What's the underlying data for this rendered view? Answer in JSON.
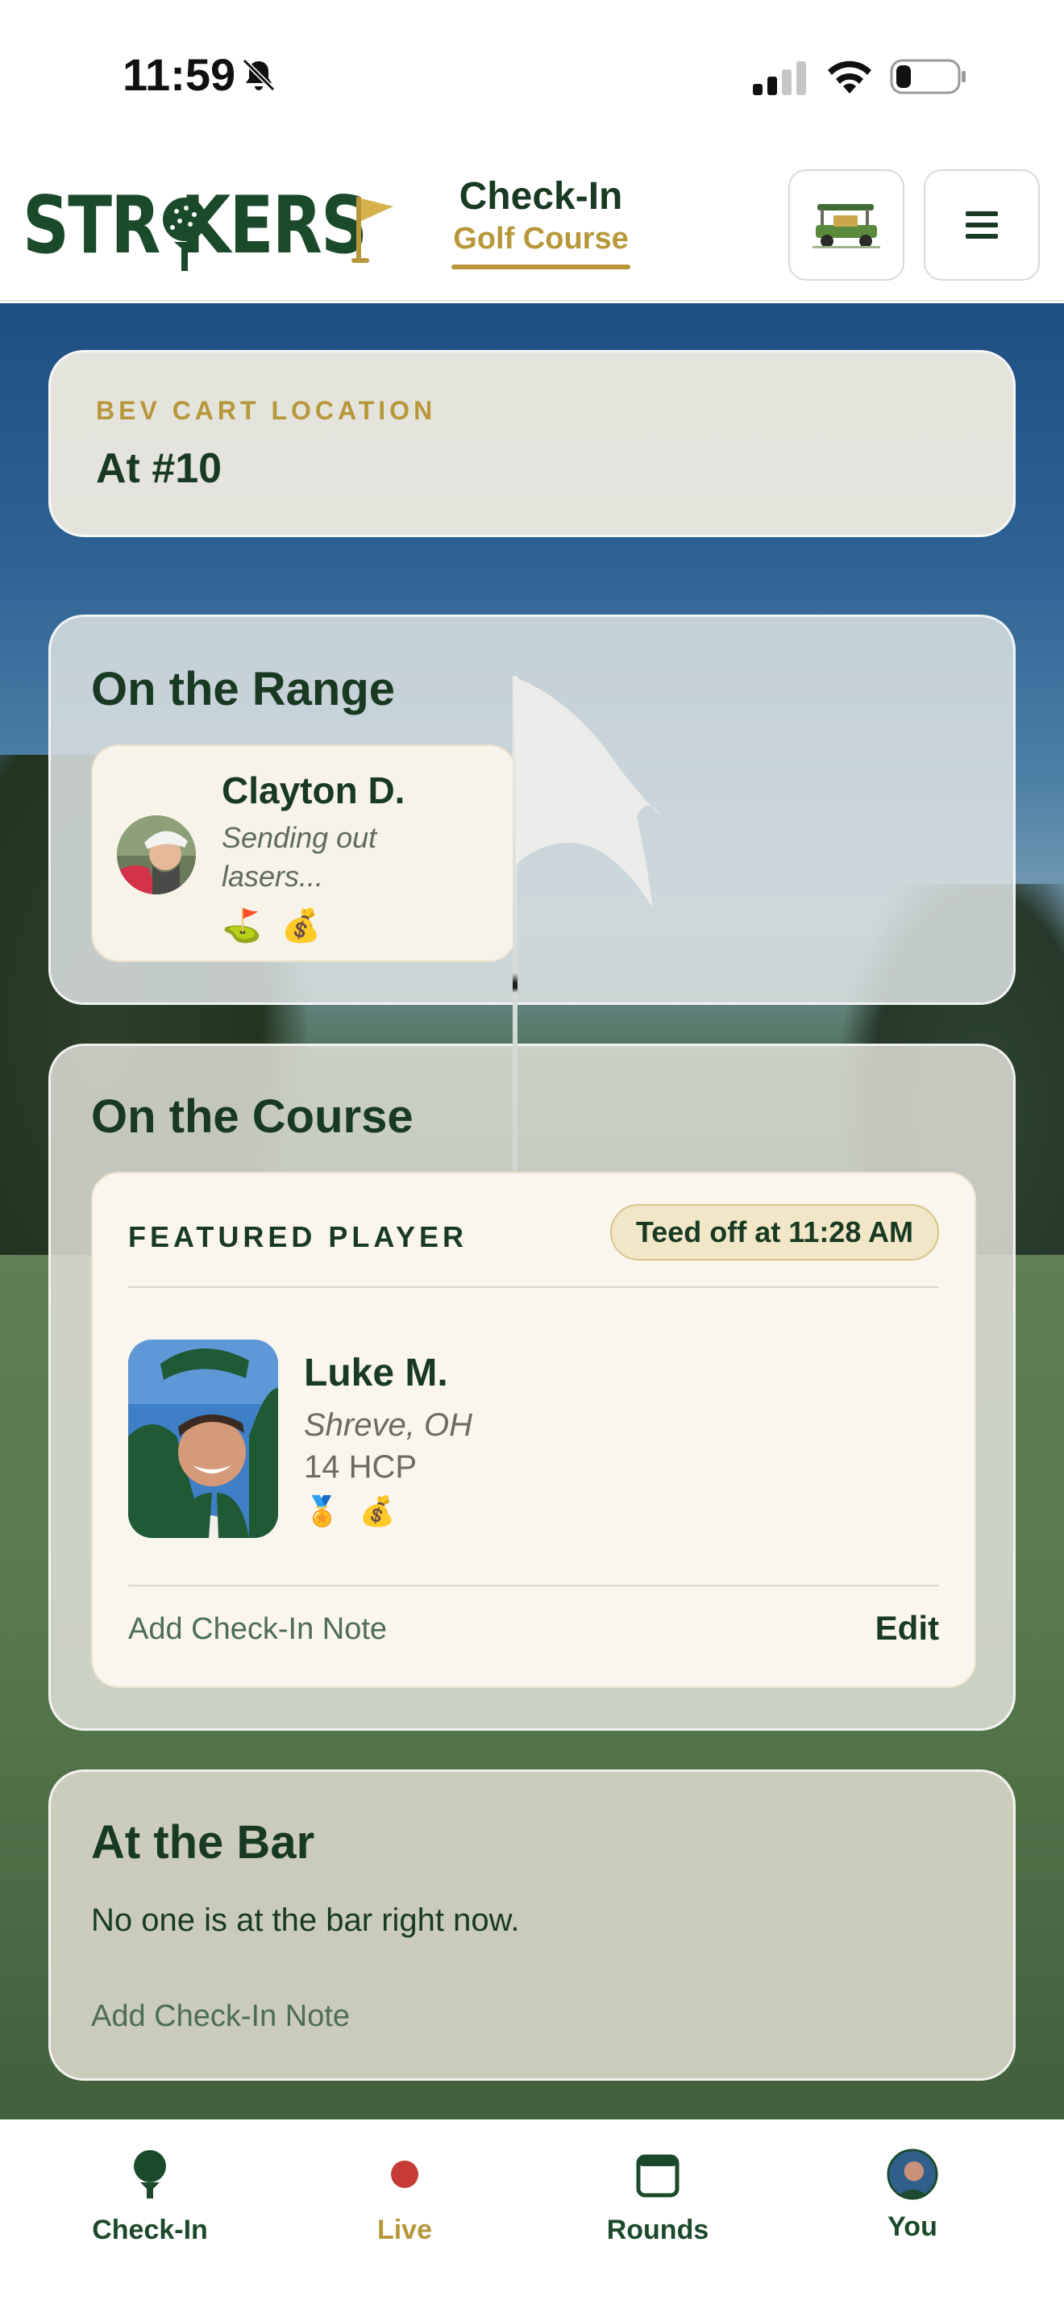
{
  "status_bar": {
    "time": "11:59"
  },
  "header": {
    "logo_text": "STR  KERS",
    "title": "Check-In",
    "subtitle": "Golf Course"
  },
  "bev_cart": {
    "label": "BEV CART LOCATION",
    "value": "At #10"
  },
  "range": {
    "title": "On the Range",
    "player": {
      "name": "Clayton D.",
      "status": "Sending out lasers...",
      "badges": [
        "⛳",
        "💰"
      ]
    }
  },
  "course": {
    "title": "On the Course",
    "featured_label": "FEATURED PLAYER",
    "teed_off": "Teed off at 11:28 AM",
    "player": {
      "name": "Luke M.",
      "location": "Shreve, OH",
      "handicap": "14 HCP",
      "badges": [
        "🏅",
        "💰"
      ]
    },
    "add_note": "Add Check-In Note",
    "edit": "Edit"
  },
  "bar": {
    "title": "At the Bar",
    "empty_text": "No one is at the bar right now.",
    "add_note": "Add Check-In Note"
  },
  "tabs": [
    {
      "label": "Check-In",
      "icon": "golf-ball-tee-icon",
      "color": "#1b4a2a"
    },
    {
      "label": "Live",
      "icon": "live-dot-icon",
      "color": "#b8973a"
    },
    {
      "label": "Rounds",
      "icon": "scorecard-icon",
      "color": "#1b4a2a"
    },
    {
      "label": "You",
      "icon": "avatar",
      "color": "#1b4a2a"
    }
  ],
  "colors": {
    "brand_green": "#1b4a2a",
    "brand_gold": "#b8973a",
    "live_red": "#c63b35"
  }
}
